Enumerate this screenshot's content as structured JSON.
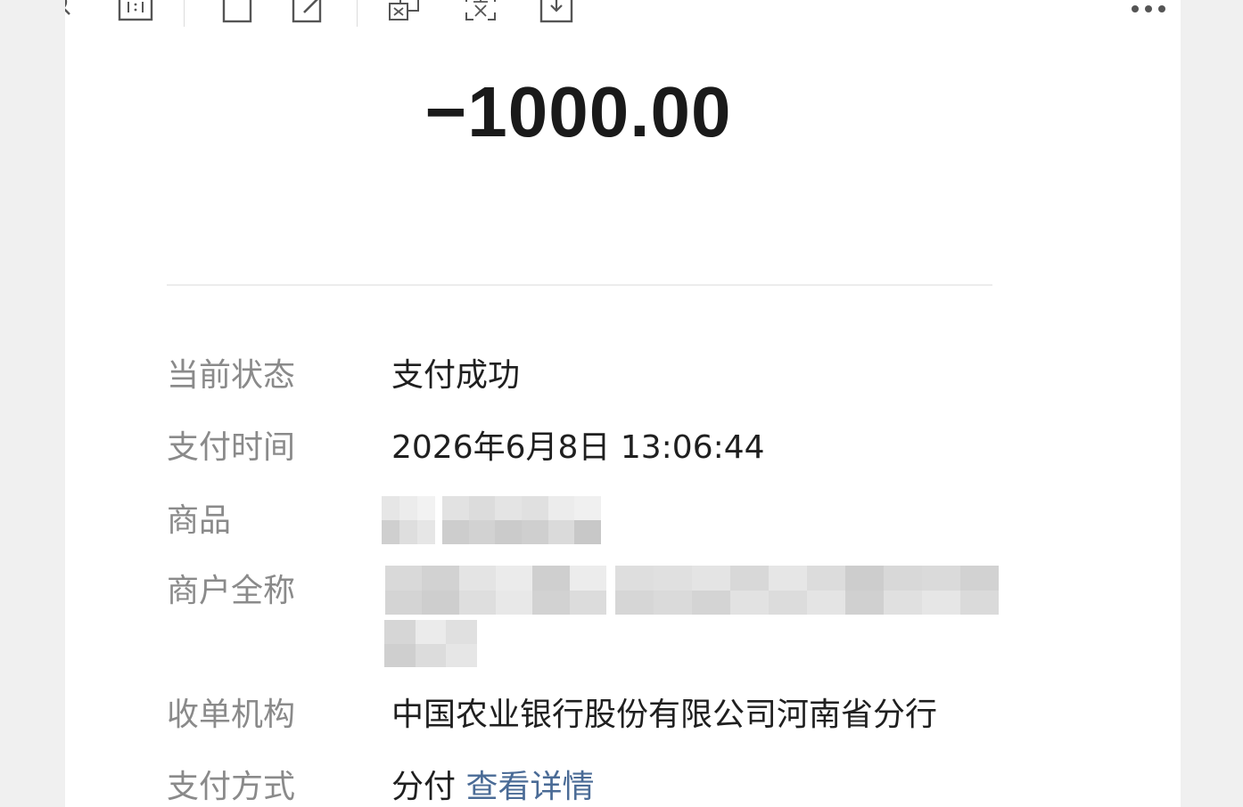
{
  "toolbar": {
    "icons": [
      "search-icon",
      "actual-size-icon",
      "crop-icon",
      "edit-icon",
      "translate-icon",
      "ocr-text-icon",
      "save-icon",
      "more-icon"
    ]
  },
  "amount": "−1000.00",
  "details": {
    "status_label": "当前状态",
    "status_value": "支付成功",
    "time_label": "支付时间",
    "time_value": "2026年6月8日 13:06:44",
    "goods_label": "商品",
    "merchant_label": "商户全称",
    "acquirer_label": "收单机构",
    "acquirer_value": "中国农业银行股份有限公司河南省分行",
    "method_label": "支付方式",
    "method_value": "分付",
    "method_link": "查看详情"
  },
  "colors": {
    "amount": "#1a1a1a",
    "label": "#8a8a8a",
    "value": "#1f1f1f",
    "link": "#4a6b96",
    "background": "#f0f0f0",
    "panel": "#ffffff"
  }
}
